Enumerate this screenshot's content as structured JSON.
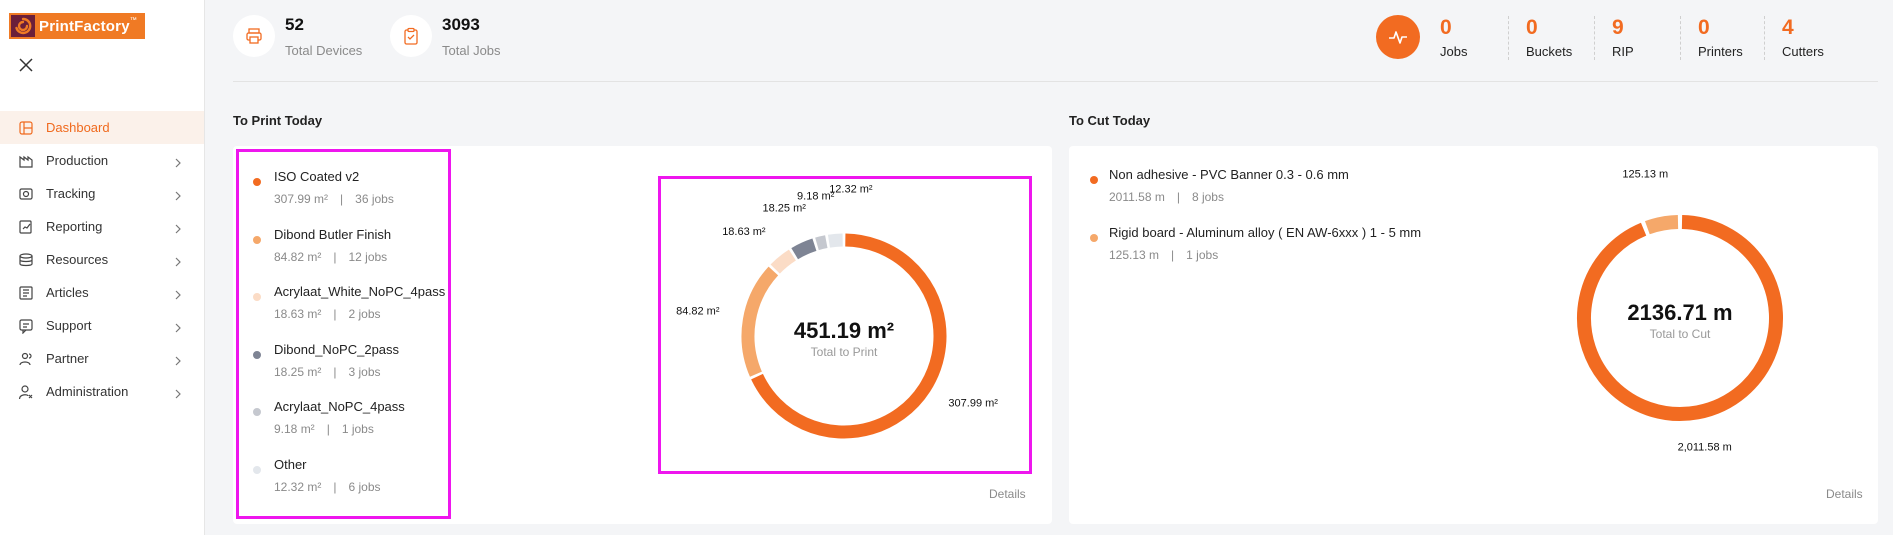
{
  "brand": {
    "name": "PrintFactory",
    "tm": "™",
    "color": "#f07a24"
  },
  "sidebar": {
    "items": [
      {
        "label": "Dashboard",
        "icon": "dashboard-icon",
        "active": true
      },
      {
        "label": "Production",
        "icon": "production-icon"
      },
      {
        "label": "Tracking",
        "icon": "tracking-icon"
      },
      {
        "label": "Reporting",
        "icon": "reporting-icon"
      },
      {
        "label": "Resources",
        "icon": "resources-icon"
      },
      {
        "label": "Articles",
        "icon": "articles-icon"
      },
      {
        "label": "Support",
        "icon": "support-icon"
      },
      {
        "label": "Partner",
        "icon": "partner-icon"
      },
      {
        "label": "Administration",
        "icon": "administration-icon"
      }
    ]
  },
  "stats": {
    "devices": {
      "value": "52",
      "label": "Total Devices",
      "icon": "printer-icon"
    },
    "jobs": {
      "value": "3093",
      "label": "Total Jobs",
      "icon": "clipboard-icon"
    }
  },
  "counters": [
    {
      "value": "0",
      "label": "Jobs"
    },
    {
      "value": "0",
      "label": "Buckets"
    },
    {
      "value": "9",
      "label": "RIP"
    },
    {
      "value": "0",
      "label": "Printers"
    },
    {
      "value": "4",
      "label": "Cutters"
    }
  ],
  "print_today": {
    "title": "To Print Today",
    "total": "451.19 m²",
    "total_label": "Total to Print",
    "details_label": "Details",
    "legend": [
      {
        "name": "ISO Coated v2",
        "area": "307.99 m²",
        "jobs": "36 jobs",
        "color": "#f26b21"
      },
      {
        "name": "Dibond Butler Finish",
        "area": "84.82 m²",
        "jobs": "12 jobs",
        "color": "#f5a86a"
      },
      {
        "name": "Acrylaat_White_NoPC_4pass",
        "area": "18.63 m²",
        "jobs": "2 jobs",
        "color": "#fbdcc6"
      },
      {
        "name": "Dibond_NoPC_2pass",
        "area": "18.25 m²",
        "jobs": "3 jobs",
        "color": "#7e8494"
      },
      {
        "name": "Acrylaat_NoPC_4pass",
        "area": "9.18 m²",
        "jobs": "1 jobs",
        "color": "#c5c8cf"
      },
      {
        "name": "Other",
        "area": "12.32 m²",
        "jobs": "6 jobs",
        "color": "#e3e7ec"
      }
    ],
    "separator": "|"
  },
  "cut_today": {
    "title": "To Cut Today",
    "total": "2136.71 m",
    "total_label": "Total to Cut",
    "details_label": "Details",
    "legend": [
      {
        "name": "Non adhesive - PVC Banner 0.3 - 0.6 mm",
        "length": "2011.58 m",
        "jobs": "8 jobs",
        "color": "#f26b21"
      },
      {
        "name": "Rigid board - Aluminum alloy ( EN AW-6xxx ) 1 - 5 mm",
        "length": "125.13 m",
        "jobs": "1 jobs",
        "color": "#f5a86a"
      }
    ],
    "separator": "|"
  },
  "chart_data": [
    {
      "type": "pie",
      "variant": "donut",
      "categories": [
        "ISO Coated v2",
        "Dibond Butler Finish",
        "Acrylaat_White_NoPC_4pass",
        "Dibond_NoPC_2pass",
        "Acrylaat_NoPC_4pass",
        "Other"
      ],
      "values": [
        307.99,
        84.82,
        18.63,
        18.25,
        9.18,
        12.32
      ],
      "data_labels": [
        "307.99 m²",
        "84.82 m²",
        "18.63 m²",
        "18.25 m²",
        "9.18 m²",
        "12.32 m²"
      ],
      "center_text": "451.19 m²",
      "center_subtext": "Total to Print",
      "colors": [
        "#f26b21",
        "#f5a86a",
        "#fbdcc6",
        "#7e8494",
        "#c5c8cf",
        "#e3e7ec"
      ]
    },
    {
      "type": "pie",
      "variant": "donut",
      "categories": [
        "Non adhesive - PVC Banner 0.3 - 0.6 mm",
        "Rigid board - Aluminum alloy ( EN AW-6xxx ) 1 - 5 mm"
      ],
      "values": [
        2011.58,
        125.13
      ],
      "data_labels": [
        "2,011.58 m",
        "125.13 m"
      ],
      "center_text": "2136.71 m",
      "center_subtext": "Total to Cut",
      "colors": [
        "#f26b21",
        "#f5a86a"
      ]
    }
  ]
}
